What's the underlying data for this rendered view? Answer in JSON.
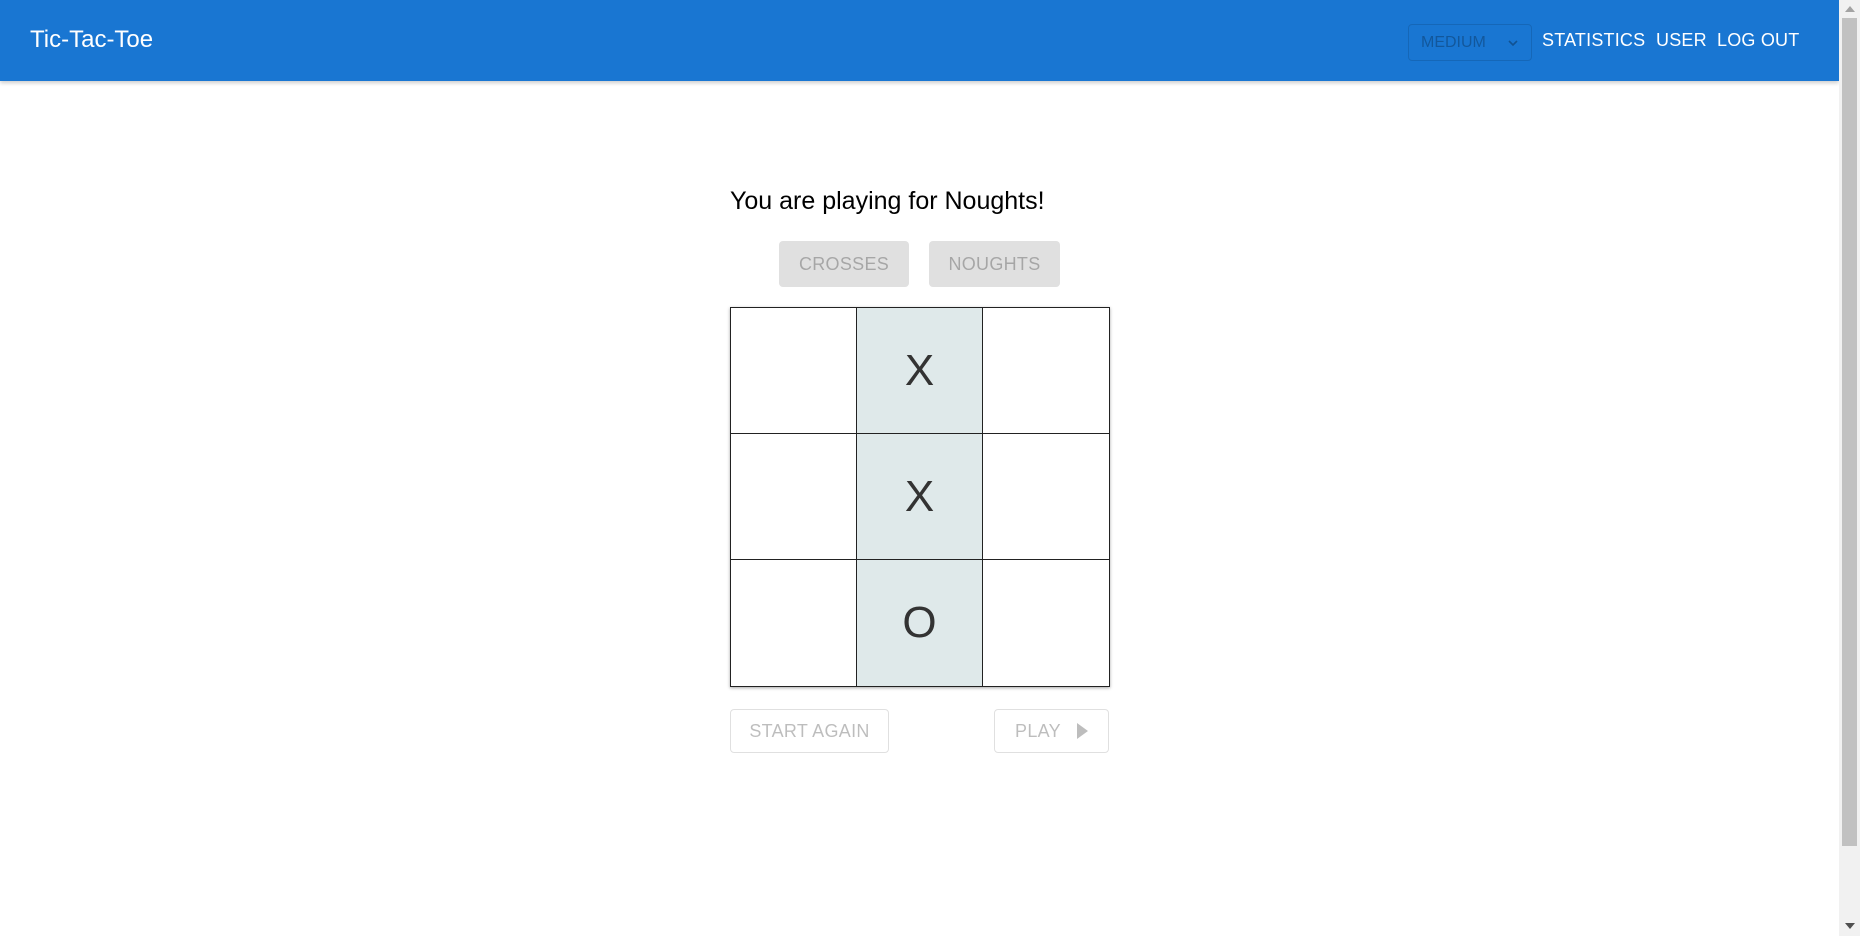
{
  "app": {
    "title": "Tic-Tac-Toe"
  },
  "header": {
    "difficulty": {
      "selected": "MEDIUM",
      "icon": "chevron-down-icon"
    },
    "nav": {
      "statistics": "STATISTICS",
      "user": "USER",
      "logout": "LOG OUT"
    }
  },
  "game": {
    "status": "You are playing for Noughts!",
    "side_buttons": {
      "crosses": "CROSSES",
      "noughts": "NOUGHTS"
    },
    "board": {
      "cells": [
        [
          "",
          "X",
          ""
        ],
        [
          "",
          "X",
          ""
        ],
        [
          "",
          "O",
          ""
        ]
      ],
      "highlighted_column": 1,
      "highlight_color": "#dfe9ea"
    },
    "actions": {
      "start_again": "START AGAIN",
      "play": "PLAY",
      "play_icon": "play-icon"
    }
  },
  "colors": {
    "appbar": "#1976d2",
    "disabled_text": "rgba(0,0,0,0.26)"
  }
}
